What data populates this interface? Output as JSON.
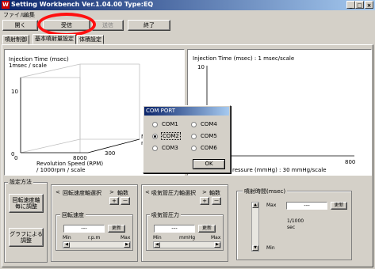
{
  "window": {
    "title": "Setting Workbench Ver.1.04.00 Type:EQ",
    "minimize": "_",
    "maximize": "□",
    "close": "×"
  },
  "menu": [
    "ファイル",
    "編集"
  ],
  "toolbar": {
    "open": "開く",
    "receive": "受信",
    "send": "送信",
    "exit": "終了"
  },
  "tabs": [
    "噴射制御",
    "基本噴射量設定",
    "体積設定"
  ],
  "chart_3d": {
    "ytitle": "Injection Time (msec)",
    "yscale": "1msec / scale",
    "ytick_max": "10",
    "ytick_zero": "0",
    "xtick_zero": "0",
    "xtick_max": "8000",
    "ztick": "300",
    "m_label": "M",
    "m_label2": "m",
    "xtitle": "Revolution Speed (RPM)",
    "xscale": "/ 1000rpm / scale"
  },
  "chart_2d": {
    "ytitle": "Injection Time (msec) : 1 msec/scale",
    "ytick_max": "10",
    "xtick_max": "800",
    "xtitle": "ressure (mmHg) : 30 mmHg/scale"
  },
  "settings_group": {
    "legend": "設定方法",
    "btn_rotation": "回転速度軸\n毎に調整",
    "btn_graph": "グラフによる\n調整"
  },
  "rpm_group": {
    "left_arrow": "<",
    "title": "回転速度軸選択",
    "right_arrow": ">",
    "axis_count": "軸数",
    "plus": "+",
    "minus": "－",
    "sub_legend": "回転速度",
    "value": "---",
    "update": "更新",
    "min": "Min",
    "unit": "r.p.m",
    "max": "Max"
  },
  "pressure_group": {
    "left_arrow": "<",
    "title": "吸気管圧力軸選択",
    "right_arrow": ">",
    "axis_count": "軸数",
    "plus": "+",
    "minus": "－",
    "sub_legend": "吸気管圧力",
    "value": "---",
    "update": "更新",
    "min": "Min",
    "unit": "mmHg",
    "max": "Max"
  },
  "injection_group": {
    "legend": "噴射時間(msec)",
    "max": "Max",
    "value": "---",
    "update": "更新",
    "fraction": "1/1000",
    "sec": "sec",
    "min": "Min"
  },
  "com_dialog": {
    "title": "COM PORT",
    "options": [
      "COM1",
      "COM2",
      "COM3",
      "COM4",
      "COM5",
      "COM6"
    ],
    "selected": "COM2",
    "ok": "OK"
  },
  "colors": {
    "titlebar_start": "#0a246a",
    "titlebar_end": "#a6caf0",
    "face": "#d4d0c8",
    "highlight_ring": "#ff1010"
  }
}
